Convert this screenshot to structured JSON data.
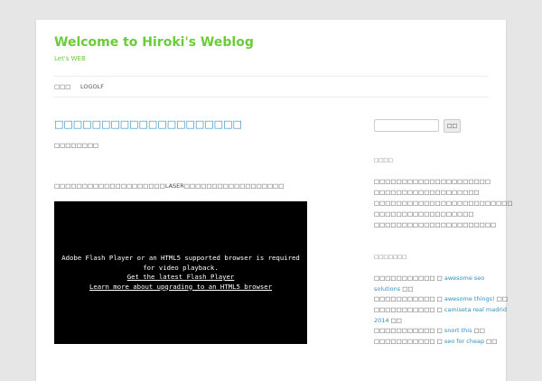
{
  "site": {
    "title": "Welcome to Hiroki's Weblog",
    "description": "Let's WEB"
  },
  "nav": {
    "items": [
      {
        "label": "□□□"
      },
      {
        "label": "LOGOLF"
      }
    ]
  },
  "post": {
    "title": "□□□□□□□□□□□□□□□□□□□□",
    "meta": "□□□□□□□□",
    "body": "□□□□□□□□□□□□□□□□□□□□LASER□□□□□□□□□□□□□□□□□□",
    "video": {
      "message": "Adobe Flash Player or an HTML5 supported browser is required for video playback.",
      "link1": "Get the latest Flash Player",
      "link2": "Learn more about upgrading to an HTML5 browser"
    }
  },
  "sidebar": {
    "search": {
      "value": "",
      "button_label": "□□"
    },
    "recent_posts": {
      "title": "□□□□",
      "items": [
        "□□□□□□□□□□□□□□□□□□□□□",
        "□□□□□□□□□□□□□□□□□□□",
        "□□□□□□□□□□□□□□□□□□□□□□□□□",
        "□□□□□□□□□□□□□□□□□□",
        "□□□□□□□□□□□□□□□□□□□□□□"
      ]
    },
    "recent_comments": {
      "title": "□□□□□□□",
      "items": [
        {
          "author": "□□□□□□□□□□□ □ ",
          "link": "awesome seo",
          "tail": ""
        },
        {
          "author": "",
          "link": "solutions",
          "tail": " □□"
        },
        {
          "author": "□□□□□□□□□□□ □ ",
          "link": "awesome things!",
          "tail": " □□"
        },
        {
          "author": "□□□□□□□□□□□ □ ",
          "link": "camiseta real madrid",
          "tail": ""
        },
        {
          "author": "",
          "link": "2014",
          "tail": " □□"
        },
        {
          "author": "□□□□□□□□□□□ □ ",
          "link": "snort this",
          "tail": " □□"
        },
        {
          "author": "□□□□□□□□□□□ □ ",
          "link": "seo for cheap",
          "tail": " □□"
        }
      ]
    }
  }
}
